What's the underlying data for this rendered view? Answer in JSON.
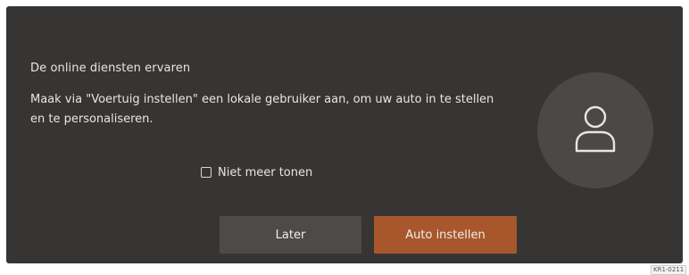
{
  "dialog": {
    "title": "De online diensten ervaren",
    "message": "Maak via \"Voertuig instellen\" een lokale gebruiker aan, om uw auto in te stellen en te personaliseren.",
    "avatar_icon": "user-icon",
    "checkbox": {
      "label": "Niet meer tonen",
      "checked": false
    },
    "buttons": {
      "later_label": "Later",
      "primary_label": "Auto instellen"
    }
  },
  "figure_code": "KR1-0211",
  "colors": {
    "background": "#363534",
    "avatar_circle": "#4a4948",
    "secondary_button": "#4c4b4a",
    "primary_button": "#a8562c",
    "text": "#e8e6e3"
  }
}
